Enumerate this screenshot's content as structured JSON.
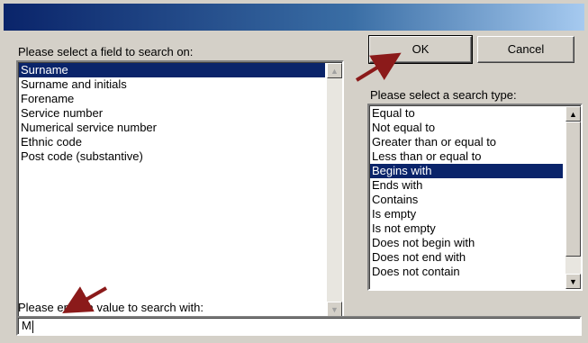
{
  "field_list": {
    "label": "Please select a field to search on:",
    "items": [
      "Surname",
      "Surname and initials",
      "Forename",
      "Service number",
      "Numerical service number",
      "Ethnic code",
      "Post code (substantive)"
    ],
    "selected_index": 0
  },
  "buttons": {
    "ok": "OK",
    "cancel": "Cancel"
  },
  "search_type": {
    "label": "Please select a search type:",
    "items": [
      "Equal to",
      "Not equal to",
      "Greater than or equal to",
      "Less than or equal to",
      "Begins with",
      "Ends with",
      "Contains",
      "Is empty",
      "Is not empty",
      "Does not begin with",
      "Does not end with",
      "Does not contain"
    ],
    "selected_index": 4
  },
  "value": {
    "label": "Please enter a value to search with:",
    "text": "M"
  },
  "colors": {
    "selection": "#0a246a",
    "annotation_arrow": "#8b1a1a"
  }
}
